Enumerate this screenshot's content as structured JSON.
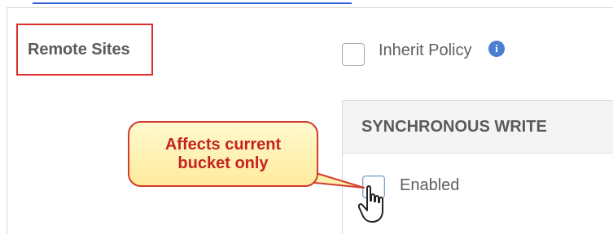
{
  "section": {
    "label": "Remote Sites"
  },
  "inherit_policy": {
    "label": "Inherit Policy",
    "info_glyph": "i"
  },
  "sync_write": {
    "title": "SYNCHRONOUS WRITE",
    "enabled_label": "Enabled"
  },
  "callout": {
    "text": "Affects current\nbucket only"
  },
  "icons": {
    "info": "info-icon",
    "cursor": "hand-pointer-icon"
  },
  "colors": {
    "highlight_border": "#df2d2d",
    "link": "#2f63d8",
    "callout_fill": "#fff3b8",
    "callout_text": "#c62222",
    "info": "#4a7fcf"
  }
}
